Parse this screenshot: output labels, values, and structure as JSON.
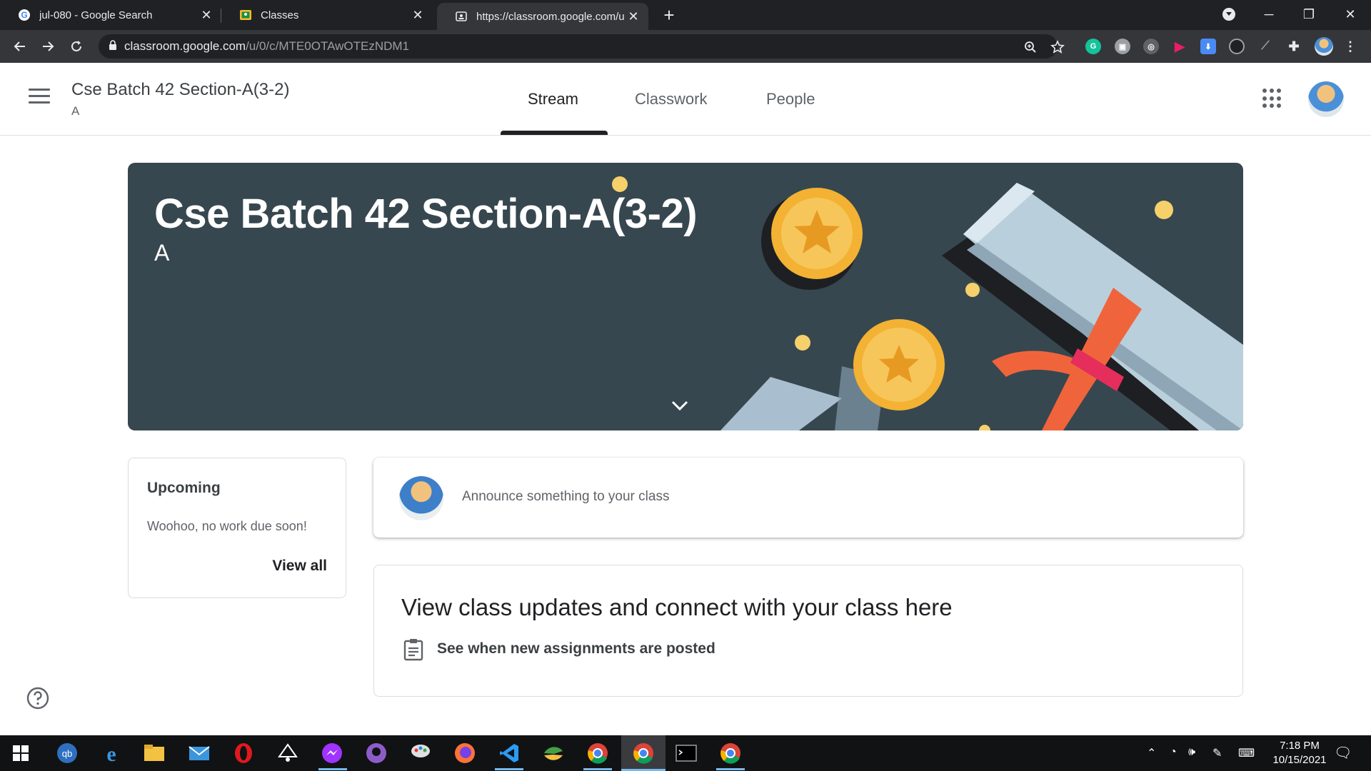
{
  "browser": {
    "tabs": [
      {
        "title": "jul-080 - Google Search",
        "icon": "google-icon"
      },
      {
        "title": "Classes",
        "icon": "classroom-icon"
      },
      {
        "title": "https://classroom.google.com/u/",
        "icon": "page-icon",
        "active": true
      }
    ],
    "url_host": "classroom.google.com",
    "url_path": "/u/0/c/MTE0OTAwOTEzNDM1"
  },
  "header": {
    "class_name": "Cse Batch 42 Section-A(3-2)",
    "section": "A",
    "tabs": [
      {
        "label": "Stream",
        "active": true
      },
      {
        "label": "Classwork"
      },
      {
        "label": "People"
      }
    ]
  },
  "banner": {
    "title": "Cse Batch 42 Section-A(3-2)",
    "section": "A",
    "background": "#37474f"
  },
  "upcoming": {
    "title": "Upcoming",
    "empty_message": "Woohoo, no work due soon!",
    "view_all": "View all"
  },
  "announce": {
    "placeholder": "Announce something to your class"
  },
  "updates": {
    "title": "View class updates and connect with your class here",
    "line": "See when new assignments are posted"
  },
  "taskbar": {
    "time": "7:18 PM",
    "date": "10/15/2021"
  },
  "colors": {
    "chrome_dark": "#202124",
    "toolbar": "#35363a",
    "banner": "#37474f",
    "gold": "#f6c344",
    "ribbon": "#f0643c"
  }
}
